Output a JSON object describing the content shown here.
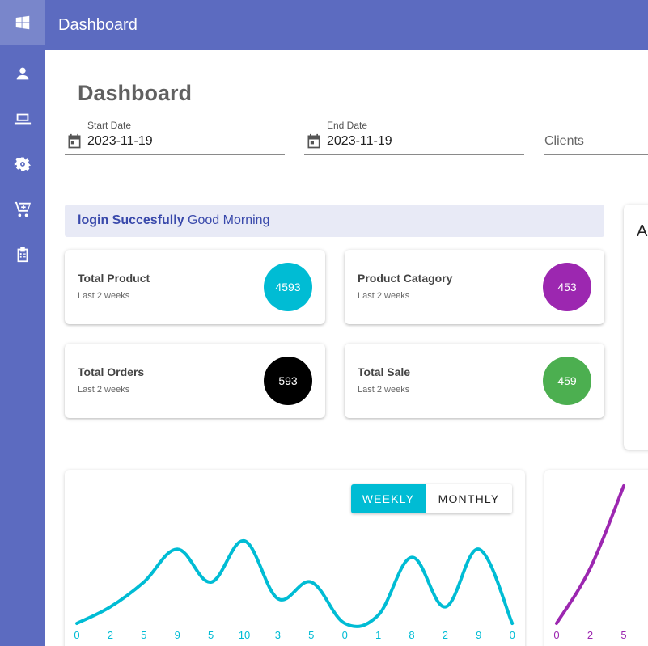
{
  "topbar": {
    "title": "Dashboard"
  },
  "sidebar": {
    "items": [
      {
        "icon": "windows-icon",
        "active": true
      },
      {
        "icon": "person-icon"
      },
      {
        "icon": "laptop-icon"
      },
      {
        "icon": "gear-icon"
      },
      {
        "icon": "cart-icon"
      },
      {
        "icon": "clipboard-icon"
      }
    ]
  },
  "page": {
    "title": "Dashboard"
  },
  "filters": {
    "start_date": {
      "label": "Start Date",
      "value": "2023-11-19"
    },
    "end_date": {
      "label": "End Date",
      "value": "2023-11-19"
    },
    "clients": {
      "placeholder": "Clients"
    }
  },
  "alert": {
    "bold": "login Succesfully",
    "text": "Good Morning"
  },
  "cards": [
    {
      "title": "Total Product",
      "subtitle": "Last 2 weeks",
      "value": "4593",
      "color": "#00bcd4"
    },
    {
      "title": "Product Catagory",
      "subtitle": "Last 2 weeks",
      "value": "453",
      "color": "#9c27b0"
    },
    {
      "title": "Total Orders",
      "subtitle": "Last 2 weeks",
      "value": "593",
      "color": "#000000"
    },
    {
      "title": "Total Sale",
      "subtitle": "Last 2 weeks",
      "value": "459",
      "color": "#4caf50"
    }
  ],
  "side_panel": {
    "title": "A"
  },
  "toggle": {
    "weekly": "WEEKLY",
    "monthly": "MONTHLY",
    "selected": "weekly"
  },
  "chart_data": [
    {
      "type": "line",
      "color": "#00bcd4",
      "values": [
        0,
        2,
        5,
        9,
        5,
        10,
        3,
        5,
        0,
        1,
        8,
        2,
        9,
        0
      ],
      "labels": [
        "0",
        "2",
        "5",
        "9",
        "5",
        "10",
        "3",
        "5",
        "0",
        "1",
        "8",
        "2",
        "9",
        "0"
      ],
      "ylim": [
        0,
        10
      ]
    },
    {
      "type": "line",
      "color": "#9c27b0",
      "values": [
        0,
        2,
        5
      ],
      "labels": [
        "0",
        "2",
        "5"
      ]
    }
  ]
}
